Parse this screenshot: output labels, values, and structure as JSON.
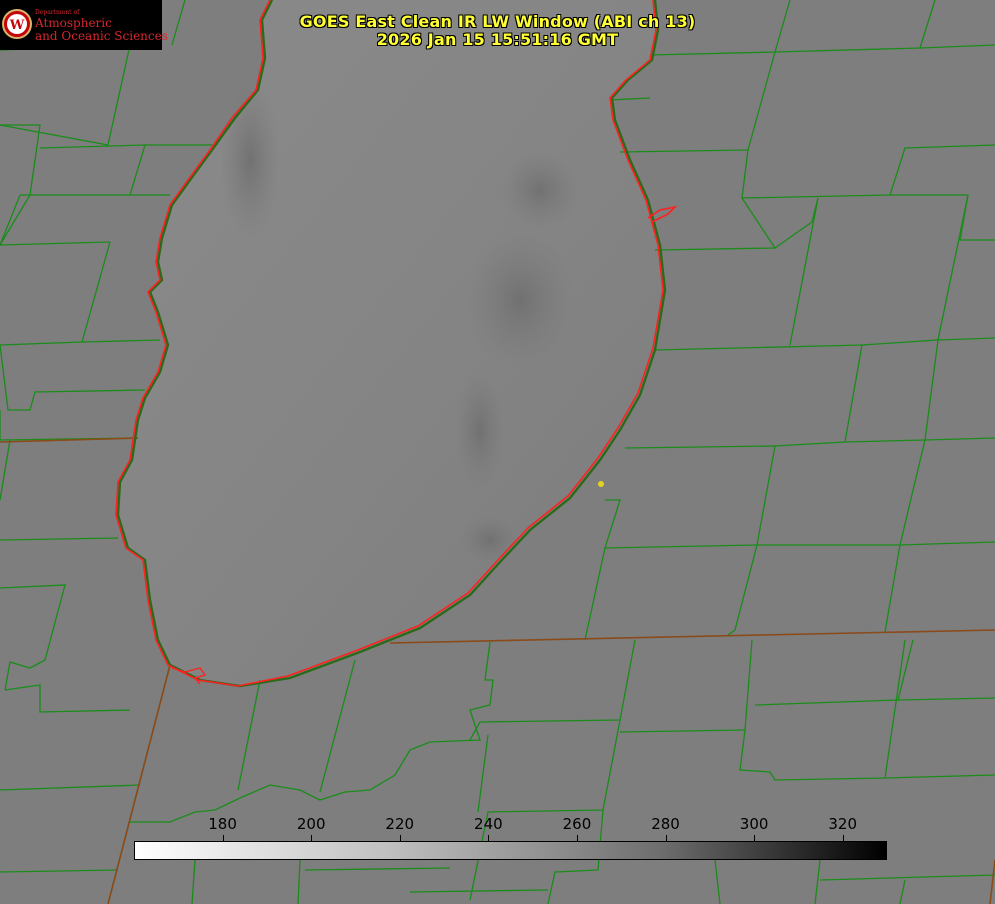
{
  "title": {
    "line1": "GOES East Clean IR LW Window (ABI ch 13)",
    "line2": "2026 Jan 15 15:51:16 GMT"
  },
  "logo": {
    "crest_letter": "W",
    "dept": "Department of",
    "line1": "Atmospheric",
    "line2": "and Oceanic Sciences"
  },
  "colors": {
    "title": "#ffff33",
    "lake_outline": "#ff2020",
    "boundaries": "#1a8c1a",
    "marker": "#e6d21e"
  },
  "colorbar": {
    "min": 160,
    "max": 330,
    "ticks": [
      180,
      200,
      220,
      240,
      260,
      280,
      300,
      320
    ],
    "colormap": "white-to-black"
  },
  "marker": {
    "type": "dot"
  }
}
